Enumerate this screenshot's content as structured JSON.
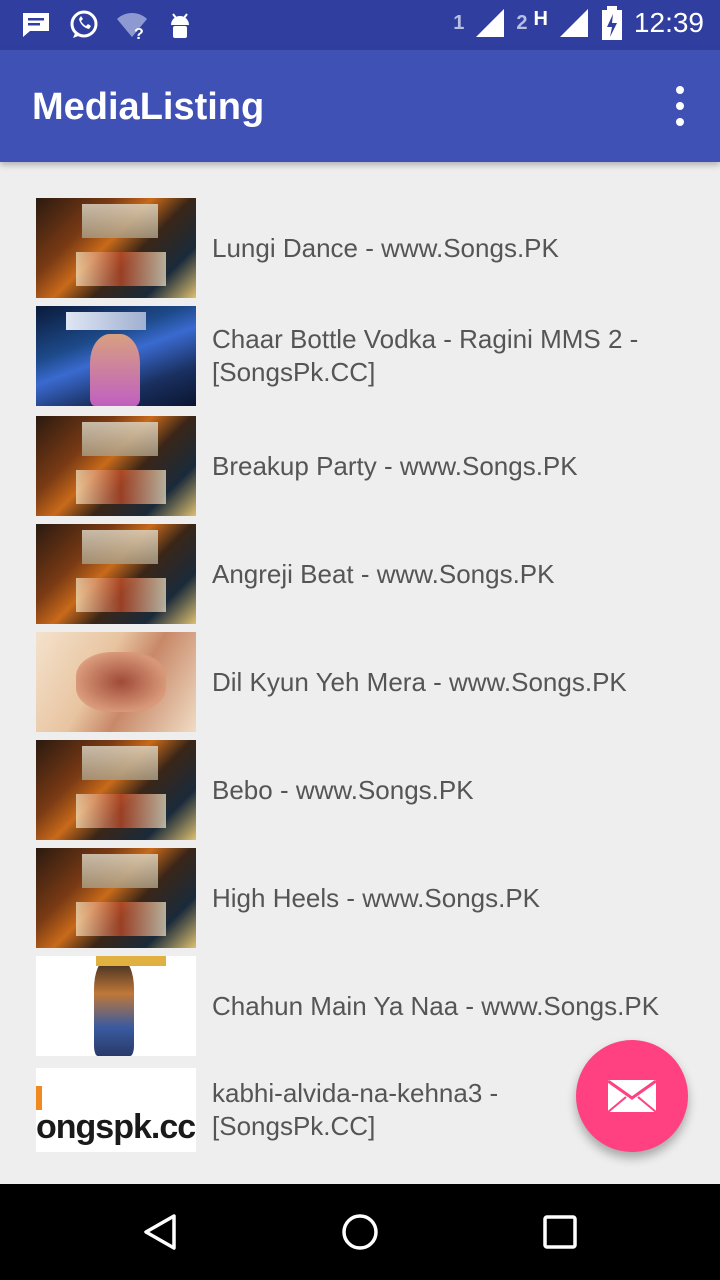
{
  "status_bar": {
    "sim1_label": "1",
    "sim2_label": "2",
    "network_type": "H",
    "time": "12:39",
    "left_icons": [
      "message-icon",
      "whatsapp-icon",
      "wifi-unknown-icon",
      "android-debug-icon"
    ],
    "right_icons": [
      "signal-sim1-icon",
      "signal-sim2-icon",
      "battery-charging-icon"
    ]
  },
  "app_bar": {
    "title": "MediaListing",
    "menu_icon": "overflow-menu-icon"
  },
  "media_items": [
    {
      "title": "Lungi Dance - www.Songs.PK",
      "thumbnail": "lungi-dance-album-art"
    },
    {
      "title": "Chaar Bottle Vodka - Ragini MMS 2 - [SongsPk.CC]",
      "thumbnail": "ragini-mms-2-album-art"
    },
    {
      "title": "Breakup Party - www.Songs.PK",
      "thumbnail": "lungi-dance-album-art"
    },
    {
      "title": "Angreji Beat - www.Songs.PK",
      "thumbnail": "lungi-dance-album-art"
    },
    {
      "title": "Dil Kyun Yeh Mera - www.Songs.PK",
      "thumbnail": "dil-kyun-album-art"
    },
    {
      "title": "Bebo - www.Songs.PK",
      "thumbnail": "lungi-dance-album-art"
    },
    {
      "title": "High Heels - www.Songs.PK",
      "thumbnail": "lungi-dance-album-art"
    },
    {
      "title": "Chahun Main Ya Naa - www.Songs.PK",
      "thumbnail": "aashiqui-2-album-art"
    },
    {
      "title": "kabhi-alvida-na-kehna3 - [SongsPk.CC]",
      "thumbnail": "songspk-logo-art",
      "thumbnail_text": "ongspk.cc"
    }
  ],
  "fab": {
    "icon": "email-icon",
    "color": "#ff4081"
  },
  "nav_bar": {
    "back_icon": "back-icon",
    "home_icon": "home-icon",
    "recents_icon": "recents-icon"
  },
  "colors": {
    "primary": "#3f51b5",
    "primary_dark": "#303f9f",
    "accent": "#ff4081",
    "background": "#eeeeee"
  }
}
